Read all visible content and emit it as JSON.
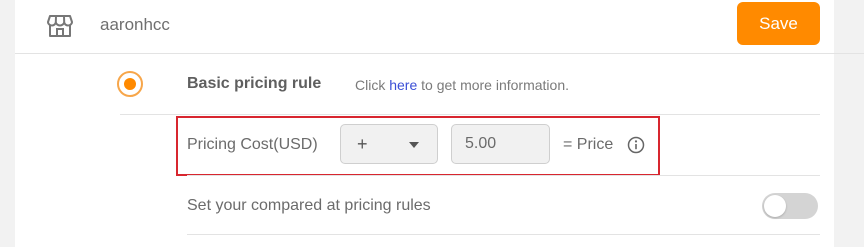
{
  "header": {
    "store_name": "aaronhcc",
    "save_label": "Save",
    "store_icon": "store-icon"
  },
  "basic_rule": {
    "title": "Basic pricing rule",
    "selected": true,
    "info_prefix": "Click",
    "info_link": "here",
    "info_suffix": "to get more information."
  },
  "formula": {
    "cost_label": "Pricing Cost(USD)",
    "operator": "+",
    "value": "5.00",
    "result_label": "= Price",
    "info_icon": "info-icon"
  },
  "compare_rule": {
    "label": "Set your compared at pricing rules",
    "enabled": false
  },
  "colors": {
    "accent": "#ff8a00",
    "highlight_border": "#d8262f",
    "link": "#3b4fd6"
  }
}
